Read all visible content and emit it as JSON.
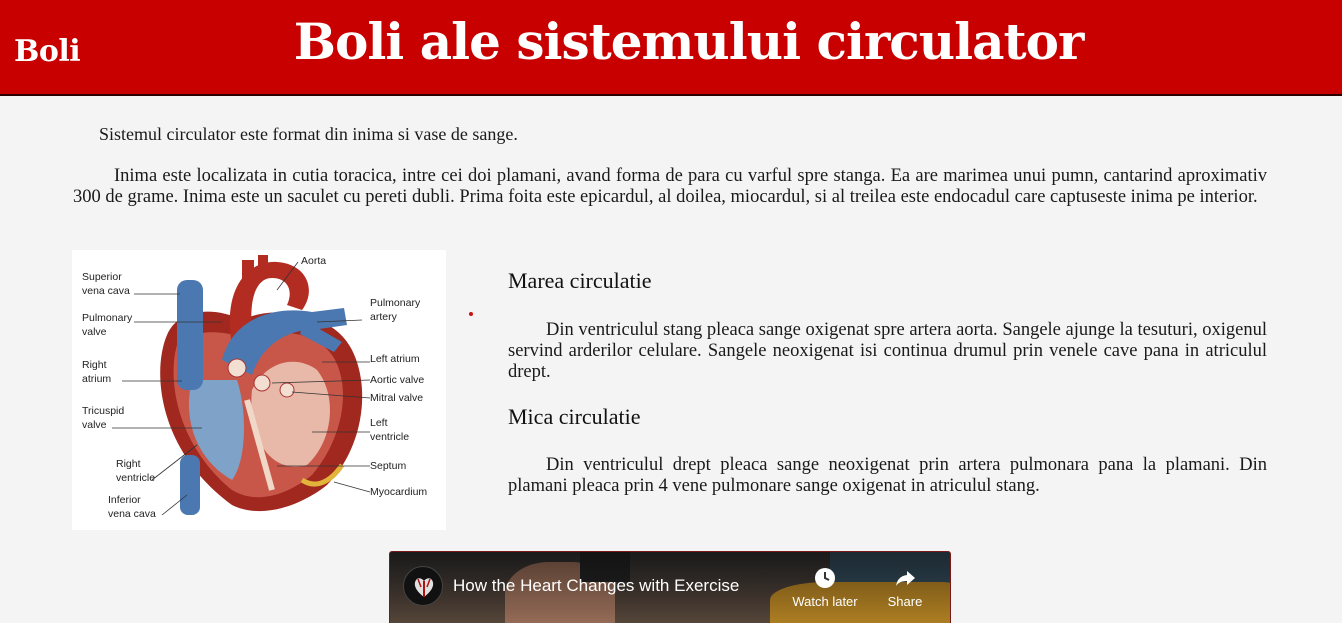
{
  "header": {
    "brand": "Boli",
    "title": "Boli ale sistemului circulator"
  },
  "intro": "Sistemul circulator este format din inima si vase de sange.",
  "paragraph": "Inima este localizata in cutia toracica, intre cei doi plamani, avand forma de para cu varful spre stanga. Ea are marimea unui pumn, cantarind aproximativ 300 de grame. Inima este un saculet cu pereti dubli. Prima foita este epicardul, al doilea, miocardul, si al treilea este endocadul care captuseste inima pe interior.",
  "diagram": {
    "labels": {
      "superior_vena_cava_1": "Superior",
      "superior_vena_cava_2": "vena cava",
      "pulmonary_valve_1": "Pulmonary",
      "pulmonary_valve_2": "valve",
      "right_atrium_1": "Right",
      "right_atrium_2": "atrium",
      "tricuspid_valve_1": "Tricuspid",
      "tricuspid_valve_2": "valve",
      "right_ventricle_1": "Right",
      "right_ventricle_2": "ventricle",
      "inferior_vena_cava_1": "Inferior",
      "inferior_vena_cava_2": "vena cava",
      "aorta": "Aorta",
      "pulmonary_artery_1": "Pulmonary",
      "pulmonary_artery_2": "artery",
      "left_atrium": "Left atrium",
      "aortic_valve": "Aortic valve",
      "mitral_valve": "Mitral valve",
      "left_ventricle_1": "Left",
      "left_ventricle_2": "ventricle",
      "septum": "Septum",
      "myocardium": "Myocardium"
    }
  },
  "sections": [
    {
      "title": "Marea circulatie",
      "text": "Din ventriculul stang pleaca sange oxigenat spre artera aorta. Sangele ajunge la tesuturi, oxigenul servind arderilor celulare. Sangele neoxigenat isi continua drumul prin venele cave pana in atriculul drept."
    },
    {
      "title": "Mica circulatie",
      "text": "Din ventriculul drept pleaca sange neoxigenat prin artera pulmonara pana la plamani. Din plamani pleaca prin 4 vene pulmonare sange oxigenat in atriculul stang."
    }
  ],
  "video": {
    "title": "How the Heart Changes with Exercise",
    "watch_later": "Watch later",
    "share": "Share"
  },
  "colors": {
    "header_bg": "#c80000",
    "page_bg": "#f5f4f4"
  }
}
